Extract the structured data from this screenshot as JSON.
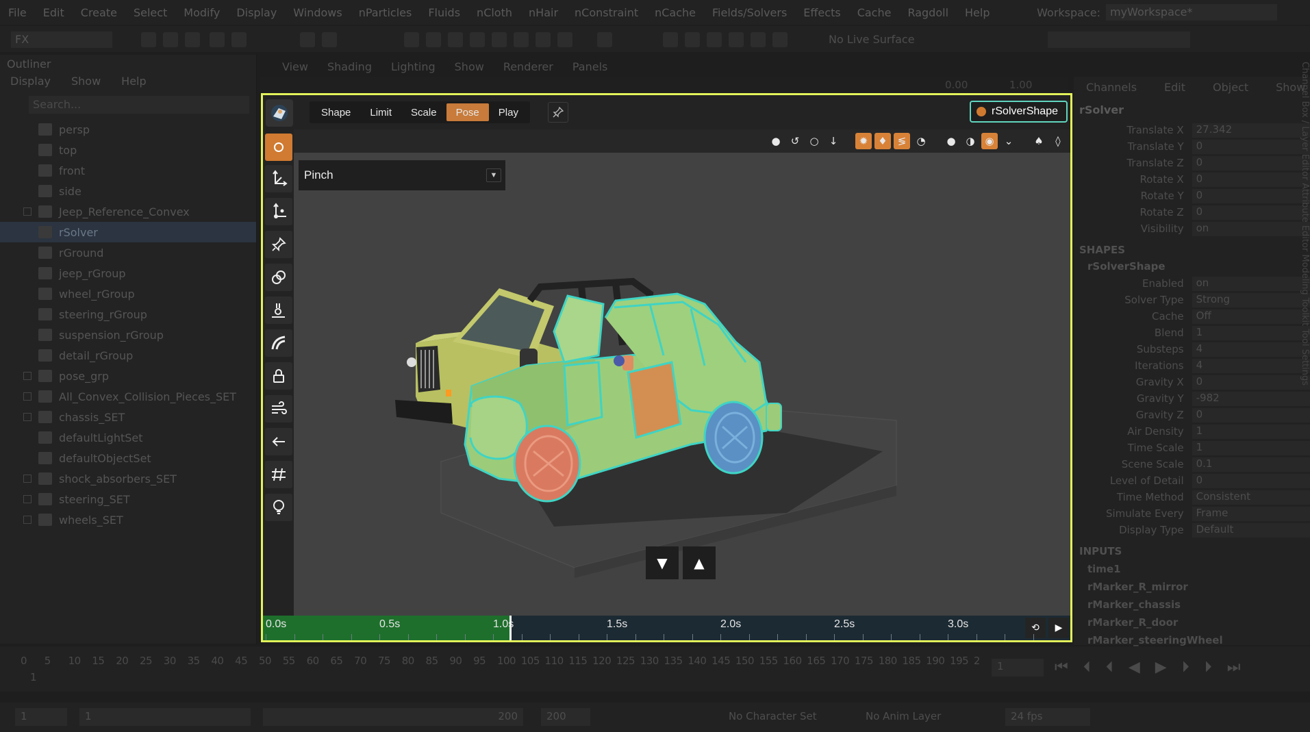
{
  "menu": [
    "File",
    "Edit",
    "Create",
    "Select",
    "Modify",
    "Display",
    "Windows",
    "nParticles",
    "Fluids",
    "nCloth",
    "nHair",
    "nConstraint",
    "nCache",
    "Fields/Solvers",
    "Effects",
    "Cache",
    "Ragdoll",
    "Help"
  ],
  "workspace": {
    "label": "Workspace:",
    "value": "myWorkspace*"
  },
  "shelf": {
    "mode": "FX",
    "live_surface": "No Live Surface"
  },
  "outliner": {
    "title": "Outliner",
    "menu": [
      "Display",
      "Show",
      "Help"
    ],
    "search_placeholder": "Search...",
    "items": [
      {
        "label": "persp",
        "selected": false
      },
      {
        "label": "top",
        "selected": false
      },
      {
        "label": "front",
        "selected": false
      },
      {
        "label": "side",
        "selected": false
      },
      {
        "label": "Jeep_Reference_Convex",
        "selected": false
      },
      {
        "label": "rSolver",
        "selected": true
      },
      {
        "label": "rGround",
        "selected": false
      },
      {
        "label": "jeep_rGroup",
        "selected": false
      },
      {
        "label": "wheel_rGroup",
        "selected": false
      },
      {
        "label": "steering_rGroup",
        "selected": false
      },
      {
        "label": "suspension_rGroup",
        "selected": false
      },
      {
        "label": "detail_rGroup",
        "selected": false
      },
      {
        "label": "pose_grp",
        "selected": false
      },
      {
        "label": "All_Convex_Collision_Pieces_SET",
        "selected": false
      },
      {
        "label": "chassis_SET",
        "selected": false
      },
      {
        "label": "defaultLightSet",
        "selected": false
      },
      {
        "label": "defaultObjectSet",
        "selected": false
      },
      {
        "label": "shock_absorbers_SET",
        "selected": false
      },
      {
        "label": "steering_SET",
        "selected": false
      },
      {
        "label": "wheels_SET",
        "selected": false
      }
    ]
  },
  "viewport_menu": [
    "View",
    "Shading",
    "Lighting",
    "Show",
    "Renderer",
    "Panels"
  ],
  "viewport_fields": {
    "a": "0.00",
    "b": "1.00"
  },
  "channel_box": {
    "tabs": [
      "Channels",
      "Edit",
      "Object",
      "Show"
    ],
    "object": "rSolver",
    "transform": [
      {
        "label": "Translate X",
        "value": "27.342"
      },
      {
        "label": "Translate Y",
        "value": "0"
      },
      {
        "label": "Translate Z",
        "value": "0"
      },
      {
        "label": "Rotate X",
        "value": "0"
      },
      {
        "label": "Rotate Y",
        "value": "0"
      },
      {
        "label": "Rotate Z",
        "value": "0"
      },
      {
        "label": "Visibility",
        "value": "on"
      }
    ],
    "shapes_header": "SHAPES",
    "shape_name": "rSolverShape",
    "shape_attrs": [
      {
        "label": "Enabled",
        "value": "on"
      },
      {
        "label": "Solver Type",
        "value": "Strong"
      },
      {
        "label": "Cache",
        "value": "Off"
      },
      {
        "label": "Blend",
        "value": "1"
      },
      {
        "label": "Substeps",
        "value": "4"
      },
      {
        "label": "Iterations",
        "value": "4"
      },
      {
        "label": "Gravity X",
        "value": "0"
      },
      {
        "label": "Gravity Y",
        "value": "-982"
      },
      {
        "label": "Gravity Z",
        "value": "0"
      },
      {
        "label": "Air Density",
        "value": "1"
      },
      {
        "label": "Time Scale",
        "value": "1"
      },
      {
        "label": "Scene Scale",
        "value": "0.1"
      },
      {
        "label": "Level of Detail",
        "value": "0"
      },
      {
        "label": "Time Method",
        "value": "Consistent"
      },
      {
        "label": "Simulate Every",
        "value": "Frame"
      },
      {
        "label": "Display Type",
        "value": "Default"
      }
    ],
    "inputs_header": "INPUTS",
    "inputs": [
      "time1",
      "rMarker_R_mirror",
      "rMarker_chassis",
      "rMarker_R_door",
      "rMarker_steeringWheel"
    ],
    "side_tabs": "Channel Box / Layer Editor   Attribute Editor   Modeling Toolkit   Tool Settings"
  },
  "timeline": {
    "ticks": [
      "0",
      "5",
      "10",
      "15",
      "20",
      "25",
      "30",
      "35",
      "40",
      "45",
      "50",
      "55",
      "60",
      "65",
      "70",
      "75",
      "80",
      "85",
      "90",
      "95",
      "100",
      "105",
      "110",
      "115",
      "120",
      "125",
      "130",
      "135",
      "140",
      "145",
      "150",
      "155",
      "160",
      "165",
      "170",
      "175",
      "180",
      "185",
      "190",
      "195",
      "2"
    ],
    "current_frame": "1",
    "frame_field": "1"
  },
  "range": {
    "start": "1",
    "start2": "1",
    "end": "200",
    "end2": "200",
    "character_set": "No Character Set",
    "anim_layer": "No Anim Layer",
    "fps": "24 fps"
  },
  "ragdoll": {
    "modes": [
      {
        "label": "Shape",
        "active": false
      },
      {
        "label": "Limit",
        "active": false
      },
      {
        "label": "Scale",
        "active": false
      },
      {
        "label": "Pose",
        "active": true
      },
      {
        "label": "Play",
        "active": false
      }
    ],
    "solver_button": "rSolverShape",
    "pose_dropdown": "Pinch",
    "timeline": {
      "labels": [
        "0.0s",
        "0.5s",
        "1.0s",
        "1.5s",
        "2.0s",
        "2.5s",
        "3.0s"
      ],
      "played_fraction": 0.31
    },
    "tool_icons": [
      "circle-icon",
      "move-axis-icon",
      "pivot-axis-icon",
      "pin-icon",
      "link-icon",
      "distance-icon",
      "curve-icon",
      "lock-icon",
      "wind-icon",
      "arrow-left-icon",
      "ground-icon",
      "light-bulb-icon"
    ],
    "colors": {
      "accent_orange": "#d07b31",
      "highlight_teal": "#3fd4c4",
      "frame_yellow": "#e2f25a",
      "timeline_green": "#1e6f2c"
    }
  }
}
